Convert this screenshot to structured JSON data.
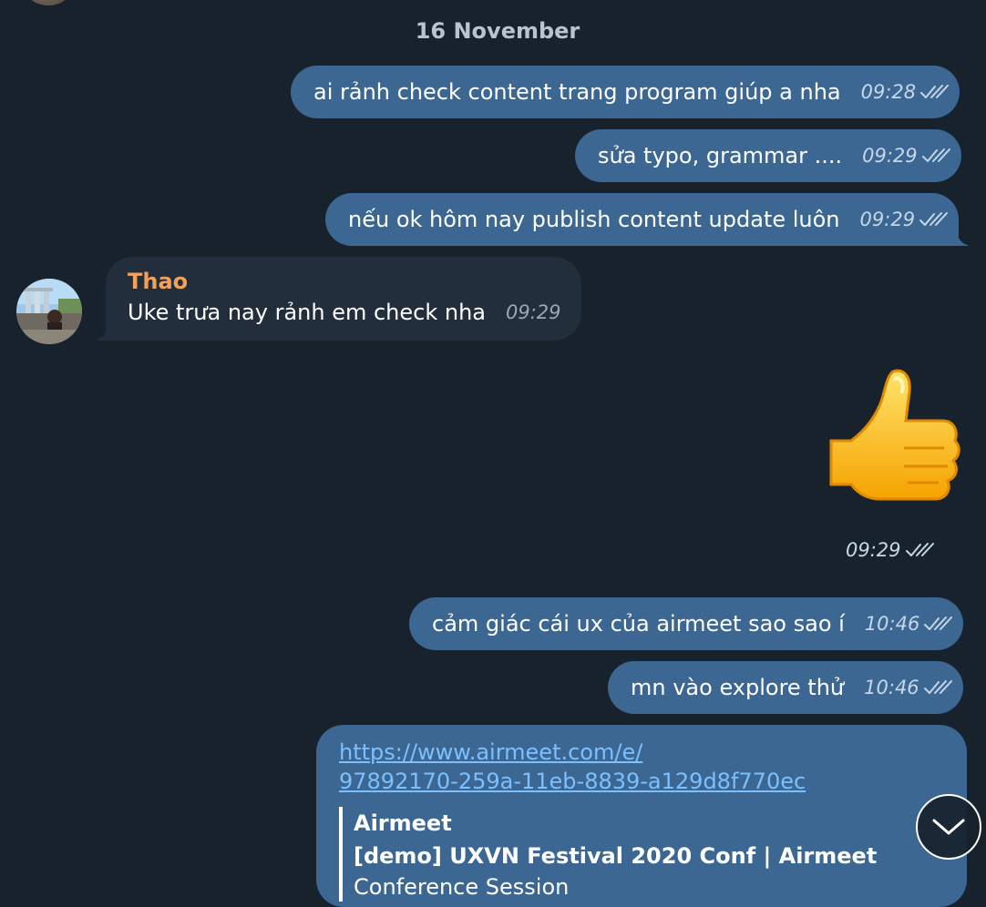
{
  "date_separator": "16 November",
  "messages": [
    {
      "text": "ai rảnh check content trang program giúp a nha",
      "time": "09:28"
    },
    {
      "text": "sửa typo, grammar ....",
      "time": "09:29"
    },
    {
      "text": "nếu ok hôm nay publish content update luôn",
      "time": "09:29"
    }
  ],
  "incoming": {
    "sender": "Thao",
    "text": "Uke trưa nay rảnh em check nha",
    "time": "09:29"
  },
  "sticker": {
    "icon": "thumbs-up-icon",
    "time": "09:29"
  },
  "messages2": [
    {
      "text": "cảm giác cái ux của airmeet sao sao í",
      "time": "10:46"
    },
    {
      "text": "mn vào explore thử",
      "time": "10:46"
    }
  ],
  "link_message": {
    "url_line1": "https://www.airmeet.com/e/",
    "url_line2": "97892170-259a-11eb-8839-a129d8f770ec",
    "preview_site": "Airmeet",
    "preview_title": "[demo] UXVN Festival 2020 Conf | Airmeet",
    "preview_desc": "Conference Session"
  },
  "colors": {
    "background": "#18222d",
    "outgoing_bubble": "#3b6792",
    "incoming_bubble": "#222e3b",
    "sender_name": "#f2a15a",
    "link": "#7cc0ff"
  }
}
